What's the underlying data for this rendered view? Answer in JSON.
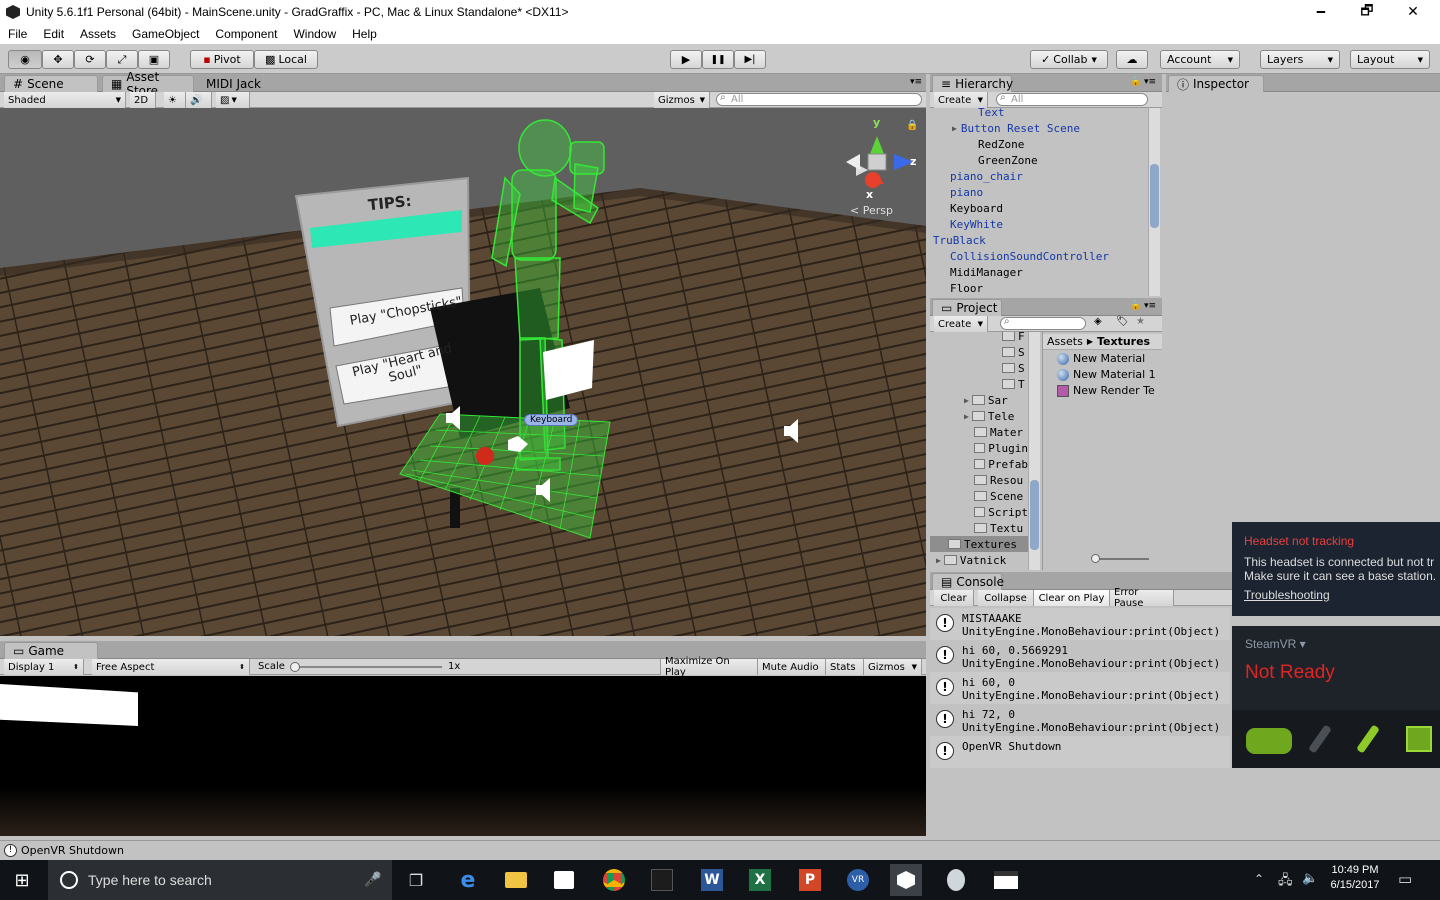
{
  "window": {
    "title": "Unity 5.6.1f1 Personal (64bit) - MainScene.unity - GradGraffix - PC, Mac & Linux Standalone* <DX11>",
    "minimize_glyph": "🗕",
    "maximize_glyph": "🗗",
    "close_glyph": "✕"
  },
  "menu": {
    "items": [
      "File",
      "Edit",
      "Assets",
      "GameObject",
      "Component",
      "Window",
      "Help"
    ]
  },
  "toolbar": {
    "pivot_label": "Pivot",
    "local_label": "Local",
    "collab_label": "Collab",
    "account_label": "Account",
    "layers_label": "Layers",
    "layout_label": "Layout",
    "play_glyph": "▶",
    "pause_glyph": "❚❚",
    "step_glyph": "▶|"
  },
  "scene": {
    "tabs": [
      "Scene",
      "Asset Store",
      "MIDI Jack"
    ],
    "shading_mode": "Shaded",
    "mode_2d": "2D",
    "gizmos_label": "Gizmos",
    "search_placeholder": "All",
    "persp_label": "Persp",
    "axis_labels": {
      "y": "y",
      "z": "z",
      "x": "x"
    },
    "tips_title": "TIPS:",
    "button1_label": "Play \"Chopsticks\"",
    "button2_label": "Play \"Heart and Soul\"",
    "keyboard_label": "Keyboard"
  },
  "game": {
    "tab": "Game",
    "display": "Display 1",
    "aspect": "Free Aspect",
    "scale_label": "Scale",
    "scale_value": "1x",
    "maximize_on_play": "Maximize On Play",
    "mute_audio": "Mute Audio",
    "stats": "Stats",
    "gizmos": "Gizmos"
  },
  "hierarchy": {
    "tab": "Hierarchy",
    "create_label": "Create",
    "search_placeholder": "All",
    "items": [
      {
        "label": "Text",
        "blue": true,
        "indent": 3,
        "arrow": false
      },
      {
        "label": "Button Reset Scene",
        "blue": true,
        "indent": 2,
        "arrow": true
      },
      {
        "label": "RedZone",
        "blue": false,
        "indent": 3,
        "arrow": false
      },
      {
        "label": "GreenZone",
        "blue": false,
        "indent": 3,
        "arrow": false
      },
      {
        "label": "piano_chair",
        "blue": true,
        "indent": 1,
        "arrow": false
      },
      {
        "label": "piano",
        "blue": true,
        "indent": 1,
        "arrow": false
      },
      {
        "label": "Keyboard",
        "blue": false,
        "indent": 1,
        "arrow": false
      },
      {
        "label": "KeyWhite",
        "blue": true,
        "indent": 1,
        "arrow": false
      },
      {
        "label": "TruBlack",
        "blue": true,
        "indent": 0,
        "arrow": true
      },
      {
        "label": "CollisionSoundController",
        "blue": true,
        "indent": 1,
        "arrow": false
      },
      {
        "label": "MidiManager",
        "blue": false,
        "indent": 1,
        "arrow": false
      },
      {
        "label": "Floor",
        "blue": false,
        "indent": 1,
        "arrow": false
      }
    ]
  },
  "inspector": {
    "tab": "Inspector"
  },
  "project": {
    "tab": "Project",
    "create_label": "Create",
    "breadcrumb_root": "Assets",
    "breadcrumb_current": "Textures",
    "folders": [
      {
        "label": "F",
        "arrow": false
      },
      {
        "label": "S",
        "arrow": false
      },
      {
        "label": "S",
        "arrow": false
      },
      {
        "label": "T",
        "arrow": false
      },
      {
        "label": "Sar",
        "arrow": true
      },
      {
        "label": "Tele",
        "arrow": true
      },
      {
        "label": "Mater",
        "arrow": false
      },
      {
        "label": "Plugin",
        "arrow": false
      },
      {
        "label": "Prefab",
        "arrow": false
      },
      {
        "label": "Resou",
        "arrow": false
      },
      {
        "label": "Scene",
        "arrow": false
      },
      {
        "label": "Script",
        "arrow": false
      },
      {
        "label": "Textu",
        "arrow": false
      },
      {
        "label": "Textures",
        "arrow": false
      },
      {
        "label": "Vatnick",
        "arrow": true
      }
    ],
    "assets": [
      "New Material",
      "New Material 1",
      "New Render Te"
    ]
  },
  "console": {
    "tab": "Console",
    "buttons": [
      "Clear",
      "Collapse",
      "Clear on Play",
      "Error Pause"
    ],
    "entries": [
      {
        "line1": "MISTAAAKE",
        "line2": "UnityEngine.MonoBehaviour:print(Object)"
      },
      {
        "line1": "hi 60, 0.5669291",
        "line2": "UnityEngine.MonoBehaviour:print(Object)"
      },
      {
        "line1": "hi 60, 0",
        "line2": "UnityEngine.MonoBehaviour:print(Object)"
      },
      {
        "line1": "hi 72, 0",
        "line2": "UnityEngine.MonoBehaviour:print(Object)"
      },
      {
        "line1": "OpenVR Shutdown",
        "line2": ""
      }
    ]
  },
  "status_bar": {
    "message": "OpenVR Shutdown"
  },
  "steamvr_notification": {
    "title": "Headset not tracking",
    "body_line1": "This headset is connected but not tr",
    "body_line2": "Make sure it can see a base station.",
    "link": "Troubleshooting"
  },
  "steamvr": {
    "menu_label": "SteamVR ▾",
    "status": "Not Ready"
  },
  "taskbar": {
    "search_placeholder": "Type here to search",
    "time": "10:49 PM",
    "date": "6/15/2017",
    "start_glyph": "⊞"
  },
  "colors": {
    "accent_green": "#2ee02e",
    "tip_teal": "#2de8b4",
    "steamvr_red": "#e02424",
    "notification_red": "#e84040"
  }
}
